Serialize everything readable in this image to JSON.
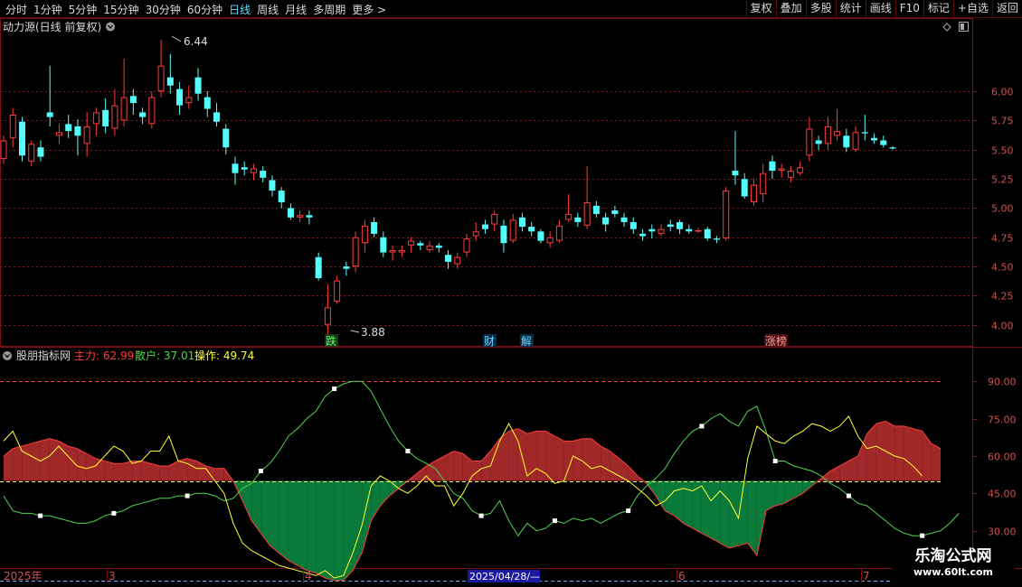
{
  "toolbar": {
    "periods": [
      "分时",
      "1分钟",
      "5分钟",
      "15分钟",
      "30分钟",
      "60分钟",
      "日线",
      "周线",
      "月线",
      "多周期",
      "更多 >"
    ],
    "active_period": "日线",
    "tools": [
      "复权",
      "叠加",
      "多股",
      "统计",
      "画线",
      "F10",
      "标记",
      "+自选",
      "返回"
    ]
  },
  "main_panel": {
    "title": "动力源(日线 前复权)",
    "high_marker": "6.44",
    "low_marker": "3.88",
    "events": [
      "跌",
      "财",
      "解",
      "涨榜"
    ]
  },
  "indicator_panel": {
    "title": "股朋指标网",
    "main_label": "主力: 62.99",
    "retail_label": "散户: 37.01",
    "operate_label": "操作: 49.74"
  },
  "date_axis": {
    "labels": [
      "2025年",
      "3",
      "4",
      "2025/04/28/—",
      "6",
      "7"
    ]
  },
  "watermark": {
    "line1": "乐淘公式网",
    "line2": "www.60lt.com"
  },
  "colors": {
    "up": "#ff3c3c",
    "down": "#54fcfc",
    "main_line": "#ff3c3c",
    "retail_line": "#4cd44c",
    "operate_line": "#ffff33",
    "fill_above": "#a02828",
    "fill_below": "#0a7a3a"
  },
  "chart_data": [
    {
      "type": "candlestick",
      "title": "动力源(日线 前复权)",
      "y_ticks": [
        4.0,
        4.25,
        4.5,
        4.75,
        5.0,
        5.25,
        5.5,
        5.75,
        6.0
      ],
      "ylim": [
        3.82,
        6.62
      ],
      "grid": true,
      "annotations": [
        {
          "text": "6.44",
          "value": 6.44
        },
        {
          "text": "3.88",
          "value": 3.88
        }
      ],
      "candles": [
        [
          5.42,
          5.58,
          5.62,
          5.38
        ],
        [
          5.6,
          5.8,
          5.86,
          5.52
        ],
        [
          5.74,
          5.45,
          5.78,
          5.4
        ],
        [
          5.4,
          5.55,
          5.58,
          5.36
        ],
        [
          5.52,
          5.44,
          5.58,
          5.4
        ],
        [
          5.82,
          5.78,
          6.22,
          5.7
        ],
        [
          5.62,
          5.65,
          5.72,
          5.55
        ],
        [
          5.72,
          5.66,
          5.8,
          5.6
        ],
        [
          5.7,
          5.62,
          5.76,
          5.45
        ],
        [
          5.55,
          5.7,
          5.82,
          5.44
        ],
        [
          5.72,
          5.82,
          5.86,
          5.62
        ],
        [
          5.84,
          5.7,
          5.94,
          5.64
        ],
        [
          5.68,
          5.88,
          6.02,
          5.62
        ],
        [
          5.75,
          5.95,
          6.28,
          5.7
        ],
        [
          5.96,
          5.9,
          6.02,
          5.8
        ],
        [
          5.82,
          5.78,
          5.86,
          5.72
        ],
        [
          5.72,
          5.95,
          6.0,
          5.68
        ],
        [
          6.0,
          6.22,
          6.44,
          5.95
        ],
        [
          6.12,
          6.05,
          6.32,
          5.98
        ],
        [
          6.02,
          5.88,
          6.08,
          5.8
        ],
        [
          5.9,
          5.95,
          6.05,
          5.85
        ],
        [
          6.12,
          5.98,
          6.2,
          5.92
        ],
        [
          5.95,
          5.85,
          6.0,
          5.78
        ],
        [
          5.82,
          5.74,
          5.9,
          5.7
        ],
        [
          5.68,
          5.52,
          5.72,
          5.46
        ],
        [
          5.38,
          5.3,
          5.44,
          5.2
        ],
        [
          5.35,
          5.33,
          5.4,
          5.28
        ],
        [
          5.3,
          5.34,
          5.38,
          5.24
        ],
        [
          5.32,
          5.26,
          5.36,
          5.22
        ],
        [
          5.24,
          5.15,
          5.28,
          5.1
        ],
        [
          5.15,
          5.05,
          5.18,
          5.0
        ],
        [
          5.0,
          4.92,
          5.04,
          4.9
        ],
        [
          4.92,
          4.94,
          4.98,
          4.88
        ],
        [
          4.94,
          4.92,
          4.98,
          4.86
        ],
        [
          4.58,
          4.4,
          4.62,
          4.38
        ],
        [
          4.0,
          4.15,
          4.35,
          3.88
        ],
        [
          4.2,
          4.38,
          4.42,
          4.18
        ],
        [
          4.5,
          4.48,
          4.54,
          4.42
        ],
        [
          4.5,
          4.75,
          4.8,
          4.45
        ],
        [
          4.7,
          4.85,
          4.9,
          4.62
        ],
        [
          4.88,
          4.78,
          4.92,
          4.75
        ],
        [
          4.75,
          4.62,
          4.8,
          4.58
        ],
        [
          4.62,
          4.64,
          4.68,
          4.55
        ],
        [
          4.62,
          4.64,
          4.68,
          4.58
        ],
        [
          4.68,
          4.72,
          4.75,
          4.62
        ],
        [
          4.7,
          4.68,
          4.72,
          4.64
        ],
        [
          4.64,
          4.68,
          4.72,
          4.62
        ],
        [
          4.68,
          4.66,
          4.7,
          4.62
        ],
        [
          4.6,
          4.54,
          4.64,
          4.48
        ],
        [
          4.52,
          4.58,
          4.62,
          4.48
        ],
        [
          4.62,
          4.74,
          4.78,
          4.58
        ],
        [
          4.76,
          4.8,
          4.88,
          4.72
        ],
        [
          4.86,
          4.82,
          4.9,
          4.78
        ],
        [
          4.86,
          4.95,
          4.98,
          4.8
        ],
        [
          4.85,
          4.7,
          4.9,
          4.62
        ],
        [
          4.72,
          4.9,
          4.95,
          4.7
        ],
        [
          4.92,
          4.84,
          4.96,
          4.8
        ],
        [
          4.84,
          4.8,
          4.88,
          4.76
        ],
        [
          4.8,
          4.72,
          4.82,
          4.7
        ],
        [
          4.7,
          4.75,
          4.8,
          4.66
        ],
        [
          4.72,
          4.85,
          4.9,
          4.7
        ],
        [
          4.9,
          4.95,
          5.12,
          4.88
        ],
        [
          4.92,
          4.88,
          4.96,
          4.84
        ],
        [
          4.85,
          5.05,
          5.36,
          4.82
        ],
        [
          5.02,
          4.95,
          5.06,
          4.92
        ],
        [
          4.92,
          4.86,
          4.96,
          4.8
        ],
        [
          4.98,
          4.95,
          5.02,
          4.92
        ],
        [
          4.92,
          4.88,
          4.96,
          4.84
        ],
        [
          4.88,
          4.82,
          4.92,
          4.78
        ],
        [
          4.78,
          4.76,
          4.82,
          4.72
        ],
        [
          4.82,
          4.8,
          4.86,
          4.74
        ],
        [
          4.78,
          4.82,
          4.86,
          4.76
        ],
        [
          4.86,
          4.84,
          4.9,
          4.8
        ],
        [
          4.88,
          4.82,
          4.9,
          4.78
        ],
        [
          4.82,
          4.8,
          4.86,
          4.78
        ],
        [
          4.81,
          4.81,
          4.83,
          4.79
        ],
        [
          4.82,
          4.74,
          4.84,
          4.72
        ],
        [
          4.74,
          4.73,
          4.76,
          4.7
        ],
        [
          4.74,
          5.15,
          5.18,
          4.72
        ],
        [
          5.32,
          5.28,
          5.66,
          5.2
        ],
        [
          5.25,
          5.1,
          5.3,
          5.08
        ],
        [
          5.05,
          5.2,
          5.25,
          5.02
        ],
        [
          5.12,
          5.3,
          5.38,
          5.05
        ],
        [
          5.4,
          5.32,
          5.45,
          5.25
        ],
        [
          5.32,
          5.34,
          5.38,
          5.26
        ],
        [
          5.26,
          5.32,
          5.36,
          5.22
        ],
        [
          5.3,
          5.35,
          5.4,
          5.28
        ],
        [
          5.45,
          5.68,
          5.78,
          5.4
        ],
        [
          5.58,
          5.55,
          5.62,
          5.5
        ],
        [
          5.55,
          5.7,
          5.78,
          5.5
        ],
        [
          5.62,
          5.66,
          5.85,
          5.58
        ],
        [
          5.62,
          5.52,
          5.68,
          5.48
        ],
        [
          5.5,
          5.65,
          5.7,
          5.48
        ],
        [
          5.65,
          5.64,
          5.8,
          5.58
        ],
        [
          5.6,
          5.58,
          5.64,
          5.55
        ],
        [
          5.58,
          5.54,
          5.62,
          5.52
        ],
        [
          5.52,
          5.51,
          5.53,
          5.5
        ]
      ]
    },
    {
      "type": "line",
      "title": "股朋指标网",
      "y_ticks": [
        30,
        45,
        60,
        75,
        90
      ],
      "ylim": [
        15,
        97
      ],
      "reference_lines": [
        90,
        50,
        10
      ],
      "series": [
        {
          "name": "主力",
          "values": [
            60,
            63,
            64,
            65,
            66,
            67,
            66,
            64,
            63,
            61,
            59,
            58,
            57,
            57,
            58,
            58,
            57,
            56,
            56,
            58,
            59,
            58,
            56,
            55,
            55,
            50,
            42,
            34,
            29,
            24,
            21,
            18,
            16,
            14,
            13,
            11,
            10,
            10,
            14,
            21,
            34,
            40,
            44,
            47,
            50,
            53,
            56,
            58,
            60,
            62,
            61,
            58,
            58,
            62,
            67,
            70,
            71,
            69,
            70,
            70,
            68,
            66,
            66,
            67,
            67,
            64,
            62,
            59,
            56,
            52,
            49,
            44,
            38,
            36,
            33,
            31,
            29,
            27,
            25,
            23,
            24,
            25,
            20,
            38,
            40,
            41,
            43,
            45,
            48,
            51,
            54,
            56,
            58,
            60,
            69,
            73,
            74,
            72,
            72,
            71,
            70,
            65,
            63
          ]
        },
        {
          "name": "散户",
          "values": [
            44,
            38,
            37,
            37,
            36,
            36,
            35,
            34,
            33,
            33,
            34,
            36,
            37,
            38,
            40,
            41,
            42,
            43,
            43,
            44,
            44,
            45,
            45,
            44,
            42,
            43,
            47,
            49,
            54,
            57,
            62,
            68,
            71,
            75,
            78,
            84,
            87,
            89,
            90,
            90,
            86,
            79,
            72,
            66,
            62,
            59,
            57,
            55,
            50,
            45,
            43,
            38,
            36,
            37,
            42,
            34,
            28,
            33,
            30,
            31,
            34,
            33,
            35,
            34,
            35,
            33,
            35,
            37,
            38,
            44,
            48,
            51,
            55,
            61,
            66,
            70,
            72,
            75,
            77,
            74,
            72,
            78,
            80,
            70,
            58,
            58,
            56,
            55,
            54,
            52,
            49,
            47,
            44,
            41,
            40,
            37,
            34,
            31,
            29,
            28,
            28,
            29,
            30,
            33,
            37
          ]
        },
        {
          "name": "操作",
          "values": [
            66,
            70,
            62,
            60,
            58,
            60,
            64,
            60,
            56,
            55,
            56,
            60,
            64,
            62,
            57,
            58,
            62,
            62,
            68,
            58,
            57,
            55,
            55,
            50,
            45,
            33,
            25,
            22,
            20,
            18,
            16,
            15,
            14,
            13,
            12,
            14,
            11,
            12,
            21,
            32,
            48,
            52,
            50,
            47,
            45,
            48,
            52,
            48,
            48,
            40,
            45,
            52,
            55,
            56,
            66,
            73,
            66,
            52,
            55,
            53,
            49,
            50,
            60,
            58,
            55,
            56,
            54,
            52,
            50,
            47,
            44,
            40,
            42,
            46,
            47,
            46,
            48,
            42,
            46,
            42,
            35,
            59,
            72,
            69,
            66,
            65,
            68,
            70,
            73,
            72,
            70,
            72,
            76,
            68,
            63,
            64,
            62,
            60,
            59,
            56,
            52
          ]
        }
      ]
    }
  ]
}
